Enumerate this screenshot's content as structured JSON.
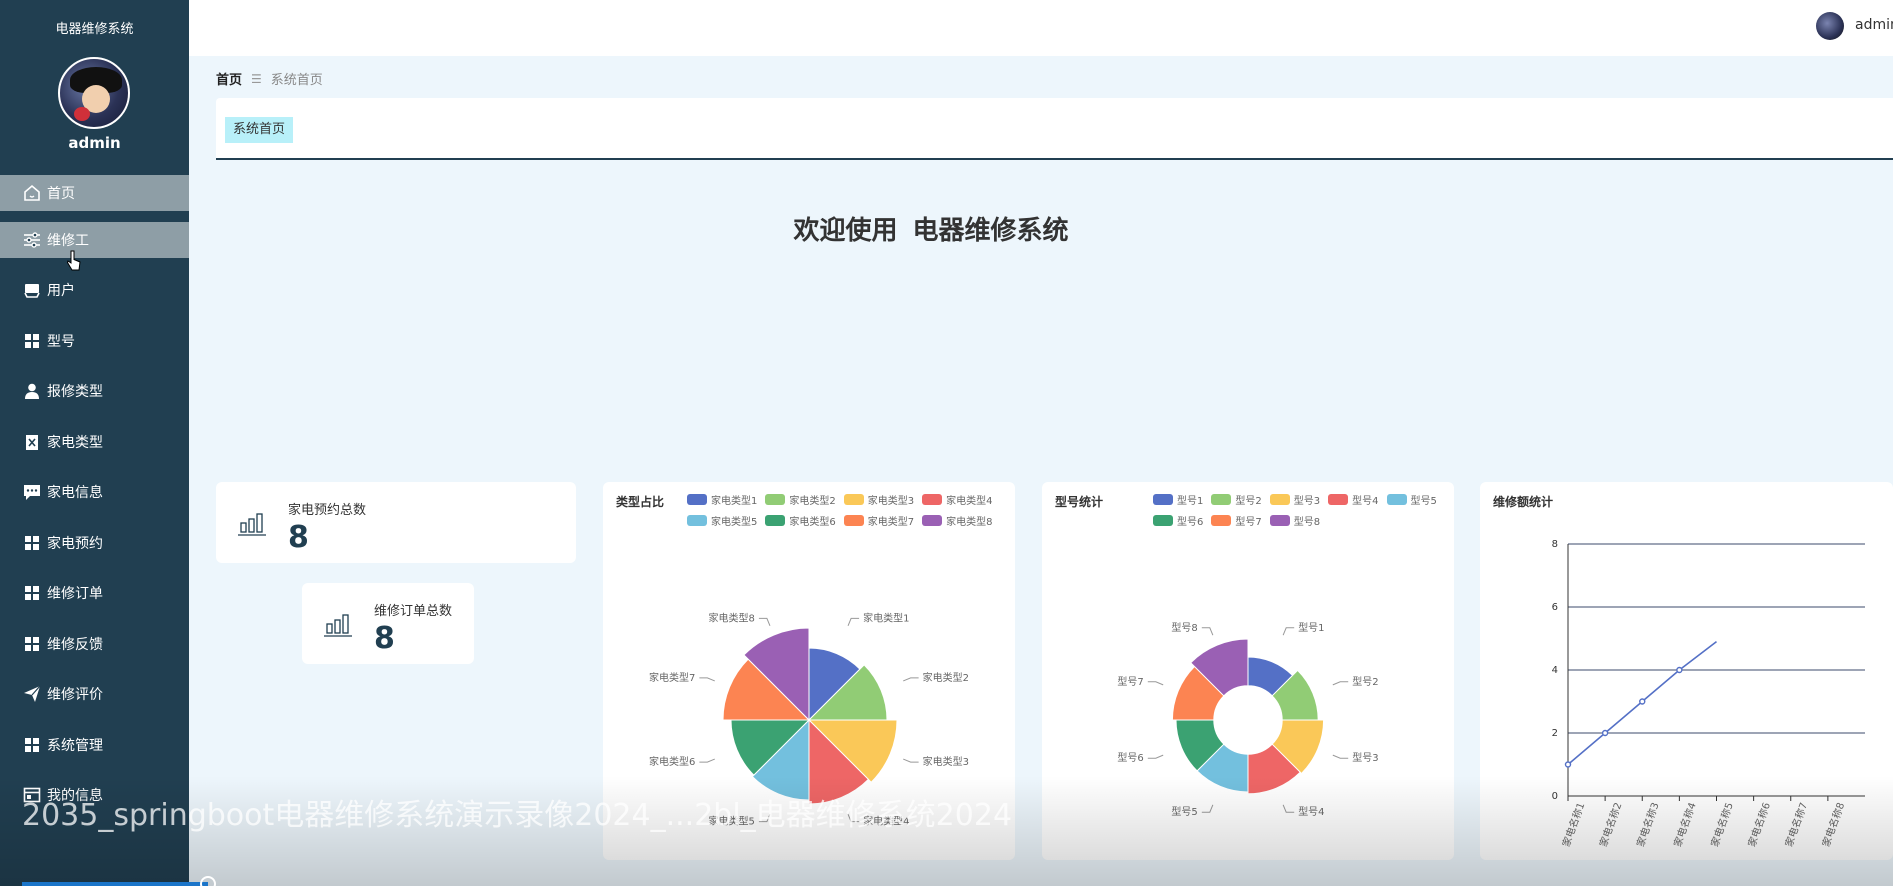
{
  "app": {
    "title": "电器维修系统",
    "user": "admin"
  },
  "sidebar": {
    "items": [
      {
        "label": "首页",
        "icon": "home-icon"
      },
      {
        "label": "维修工",
        "icon": "sliders-icon"
      },
      {
        "label": "用户",
        "icon": "inbox-icon"
      },
      {
        "label": "型号",
        "icon": "grid-icon"
      },
      {
        "label": "报修类型",
        "icon": "user-icon"
      },
      {
        "label": "家电类型",
        "icon": "clipboard-icon"
      },
      {
        "label": "家电信息",
        "icon": "chat-icon"
      },
      {
        "label": "家电预约",
        "icon": "grid-icon"
      },
      {
        "label": "维修订单",
        "icon": "grid-icon"
      },
      {
        "label": "维修反馈",
        "icon": "grid-icon"
      },
      {
        "label": "维修评价",
        "icon": "send-icon"
      },
      {
        "label": "系统管理",
        "icon": "grid-icon"
      },
      {
        "label": "我的信息",
        "icon": "card-icon"
      }
    ]
  },
  "breadcrumb": {
    "home": "首页",
    "separator": "☰",
    "current": "系统首页"
  },
  "tabs": [
    {
      "label": "系统首页"
    }
  ],
  "welcome": {
    "prefix": "欢迎使用",
    "name": "电器维修系统"
  },
  "stats": [
    {
      "label": "家电预约总数",
      "value": "8"
    },
    {
      "label": "维修订单总数",
      "value": "8"
    }
  ],
  "colors": [
    "#5470c6",
    "#91cc75",
    "#fac858",
    "#ee6666",
    "#73c0de",
    "#3ba272",
    "#fc8452",
    "#9a60b4"
  ],
  "chart_data": [
    {
      "type": "pie",
      "title": "类型占比",
      "categories": [
        "家电类型1",
        "家电类型2",
        "家电类型3",
        "家电类型4",
        "家电类型5",
        "家电类型6",
        "家电类型7",
        "家电类型8"
      ],
      "values": [
        1,
        1,
        1,
        1,
        1,
        1,
        1,
        1
      ],
      "radii": [
        0.72,
        0.78,
        0.88,
        0.84,
        0.8,
        0.78,
        0.86,
        0.92
      ],
      "inner_radius": 0,
      "legend": "top-right"
    },
    {
      "type": "pie",
      "title": "型号统计",
      "categories": [
        "型号1",
        "型号2",
        "型号3",
        "型号4",
        "型号5",
        "型号6",
        "型号7",
        "型号8"
      ],
      "values": [
        1,
        1,
        1,
        1,
        1,
        1,
        1,
        1
      ],
      "radii": [
        0.7,
        0.78,
        0.84,
        0.82,
        0.8,
        0.8,
        0.84,
        0.9
      ],
      "inner_radius": 0.38,
      "legend": "top-right"
    },
    {
      "type": "line",
      "title": "维修额统计",
      "categories": [
        "家电名称1",
        "家电名称2",
        "家电名称3",
        "家电名称4",
        "家电名称5",
        "家电名称6",
        "家电名称7",
        "家电名称8"
      ],
      "values": [
        1,
        2,
        3,
        4,
        4.9
      ],
      "ylim": [
        0,
        8
      ],
      "yticks": [
        0,
        2,
        4,
        6,
        8
      ],
      "grid": true
    }
  ],
  "watermark": "2035_springboot电器维修系统演示录像2024_...2bl_电器维修系统2024"
}
